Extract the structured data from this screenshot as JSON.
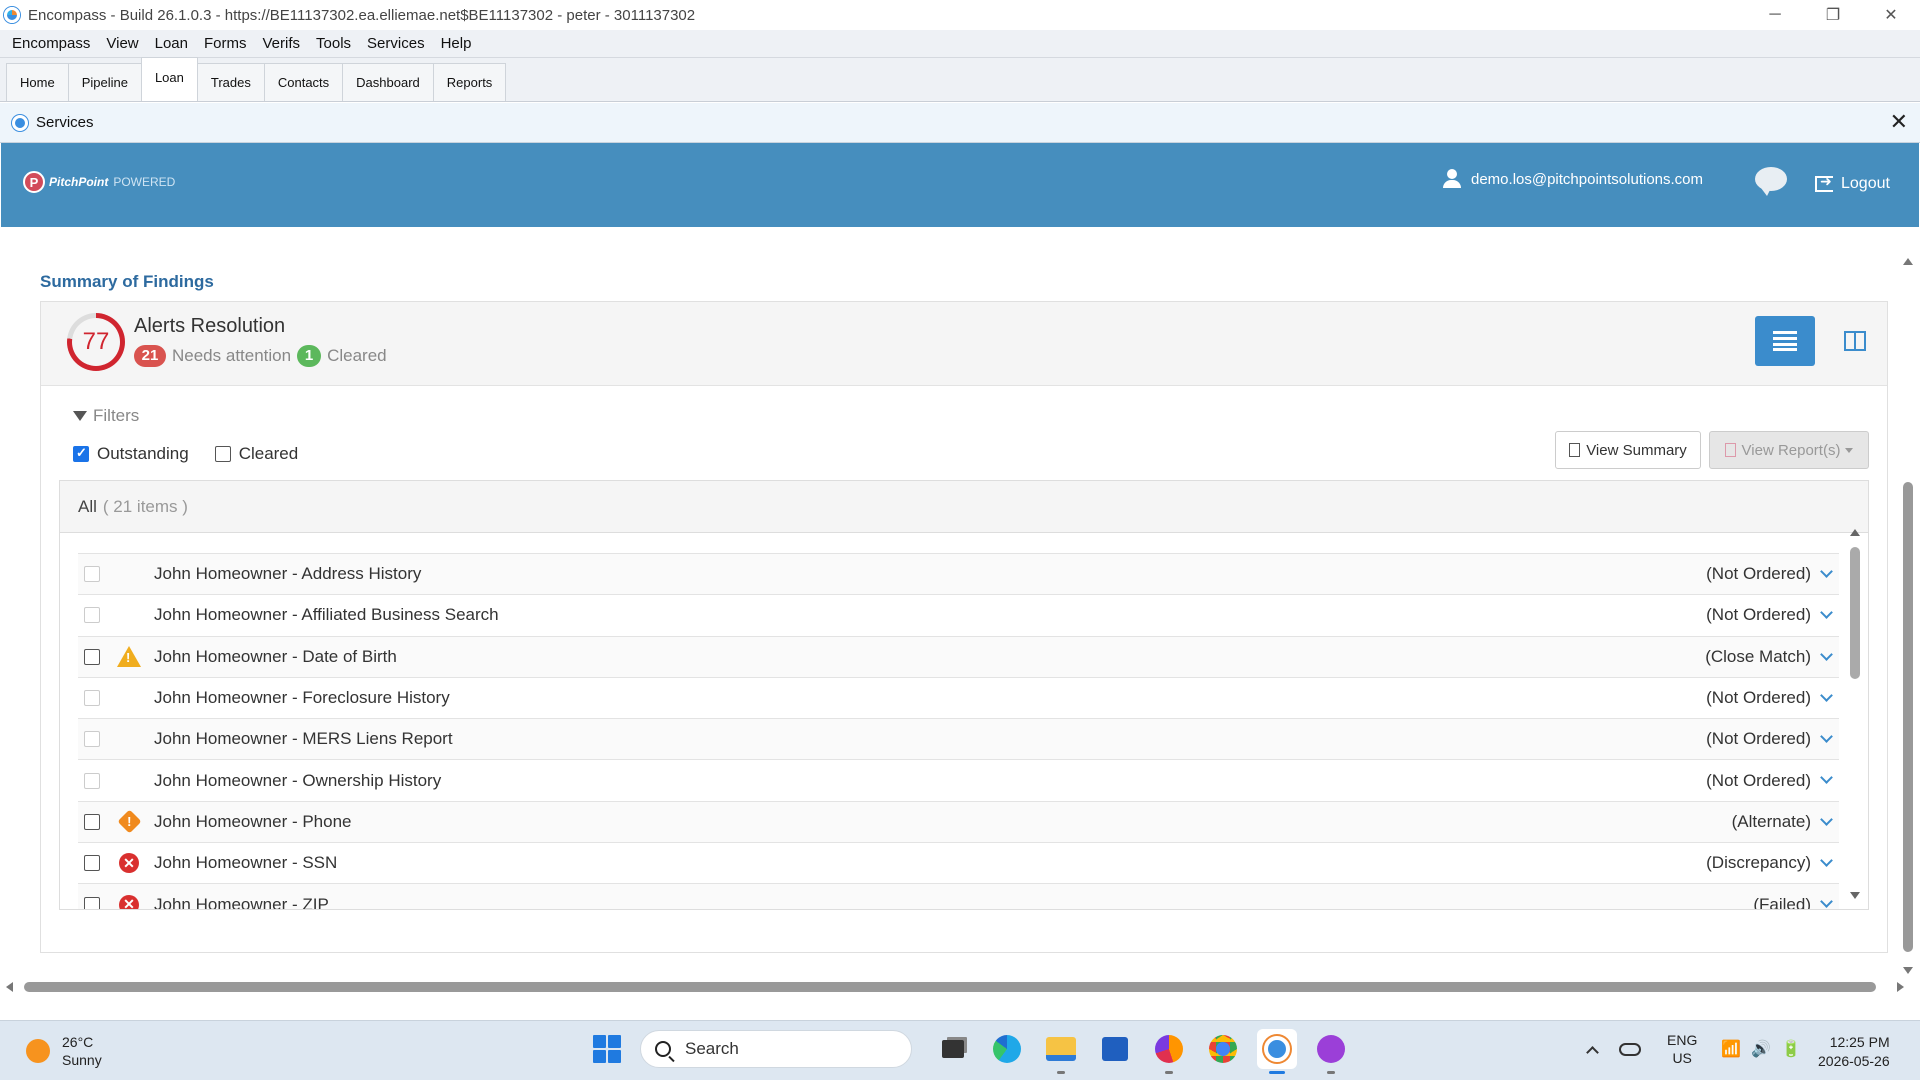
{
  "window": {
    "title": "Encompass - Build 26.1.0.3 - https://BE11137302.ea.elliemae.net$BE11137302 - peter - 3011137302",
    "minimize": "─",
    "restore": "❐",
    "close": "✕"
  },
  "menu": [
    "Encompass",
    "View",
    "Loan",
    "Forms",
    "Verifs",
    "Tools",
    "Services",
    "Help"
  ],
  "tabs": [
    {
      "label": "Home",
      "active": false
    },
    {
      "label": "Pipeline",
      "active": false
    },
    {
      "label": "Loan",
      "active": true
    },
    {
      "label": "Trades",
      "active": false
    },
    {
      "label": "Contacts",
      "active": false
    },
    {
      "label": "Dashboard",
      "active": false
    },
    {
      "label": "Reports",
      "active": false
    }
  ],
  "services": {
    "title": "Services",
    "close": "✕"
  },
  "header": {
    "brand": "PitchPoint",
    "powered": "POWERED",
    "logo_mark": "P",
    "user_email": "demo.los@pitchpointsolutions.com",
    "logout": "Logout",
    "accent_color": "#468ebe"
  },
  "summary": {
    "title": "Summary of Findings",
    "score": "77",
    "score_fraction": 0.77,
    "alerts_title": "Alerts Resolution",
    "needs_attention_count": "21",
    "needs_attention_label": "Needs attention",
    "cleared_count": "1",
    "cleared_label": "Cleared"
  },
  "filters": {
    "label": "Filters",
    "outstanding": {
      "label": "Outstanding",
      "checked": true
    },
    "cleared": {
      "label": "Cleared",
      "checked": false
    }
  },
  "buttons": {
    "view_summary": "View Summary",
    "view_reports": "View Report(s)"
  },
  "list": {
    "header_label": "All",
    "header_count": "( 21 items )",
    "rows": [
      {
        "label": "John Homeowner - Address History",
        "status": "(Not Ordered)",
        "icon": "none",
        "checkbox_enabled": false
      },
      {
        "label": "John Homeowner - Affiliated Business Search",
        "status": "(Not Ordered)",
        "icon": "none",
        "checkbox_enabled": false
      },
      {
        "label": "John Homeowner - Date of Birth",
        "status": "(Close Match)",
        "icon": "warning-triangle-icon",
        "checkbox_enabled": true
      },
      {
        "label": "John Homeowner - Foreclosure History",
        "status": "(Not Ordered)",
        "icon": "none",
        "checkbox_enabled": false
      },
      {
        "label": "John Homeowner - MERS Liens Report",
        "status": "(Not Ordered)",
        "icon": "none",
        "checkbox_enabled": false
      },
      {
        "label": "John Homeowner - Ownership History",
        "status": "(Not Ordered)",
        "icon": "none",
        "checkbox_enabled": false
      },
      {
        "label": "John Homeowner - Phone",
        "status": "(Alternate)",
        "icon": "warning-diamond-icon",
        "checkbox_enabled": true
      },
      {
        "label": "John Homeowner - SSN",
        "status": "(Discrepancy)",
        "icon": "error-circle-icon",
        "checkbox_enabled": true
      },
      {
        "label": "John Homeowner - ZIP",
        "status": "(Failed)",
        "icon": "error-circle-icon",
        "checkbox_enabled": true
      }
    ]
  },
  "taskbar": {
    "temperature": "26°C",
    "condition": "Sunny",
    "search_placeholder": "Search",
    "apps": [
      "task-view-icon",
      "edge-icon",
      "file-explorer-icon",
      "store-icon",
      "firefox-icon",
      "chrome-icon",
      "encompass-icon",
      "app-icon"
    ],
    "lang_top": "ENG",
    "lang_bottom": "US",
    "wifi": "📶",
    "volume": "🔊",
    "battery": "🔋",
    "time": "12:25 PM",
    "date": "2026-05-26"
  }
}
